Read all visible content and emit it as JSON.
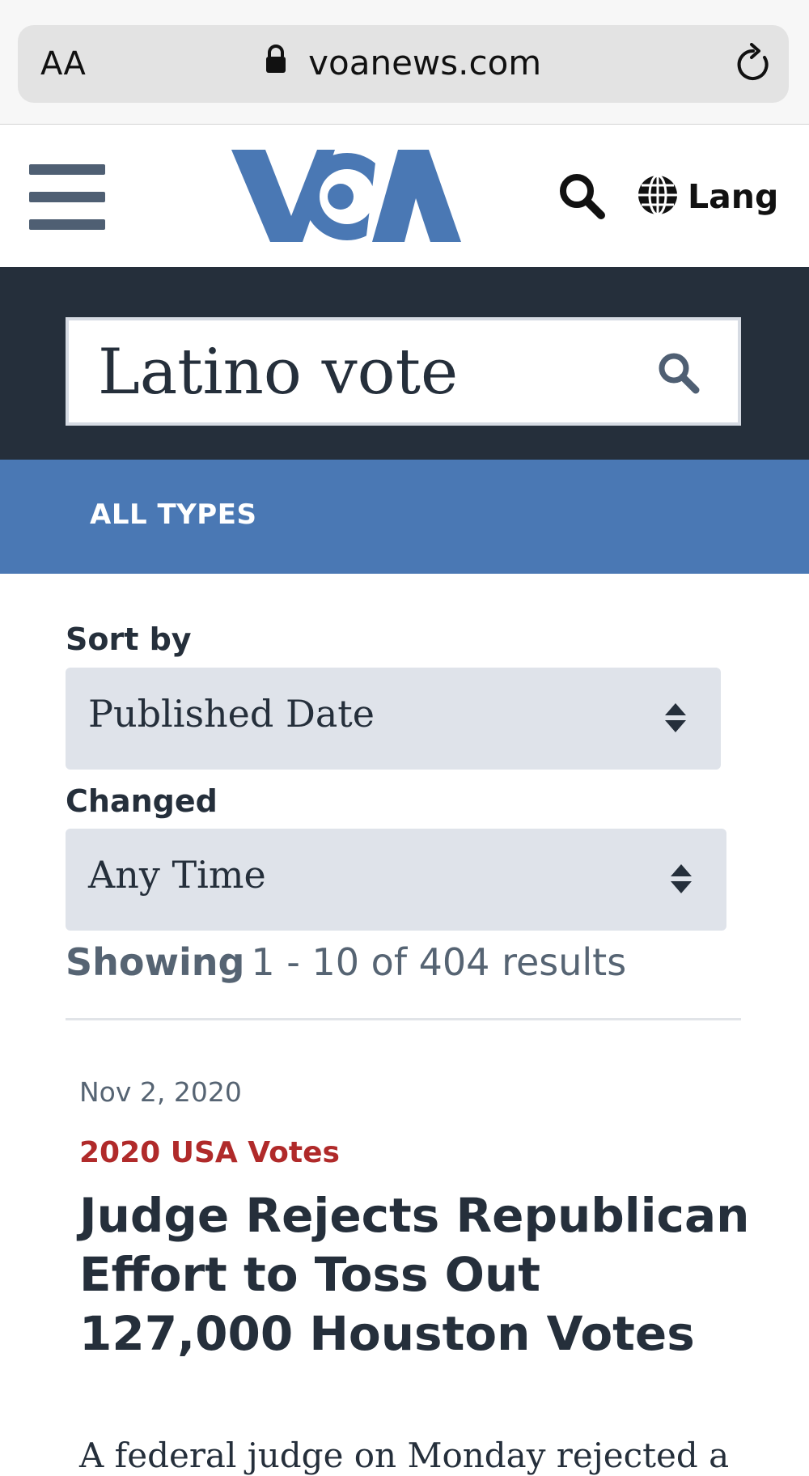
{
  "browser": {
    "text_size_label": "AA",
    "url": "voanews.com",
    "lock_icon": "lock-icon",
    "reload_icon": "reload-icon"
  },
  "header": {
    "menu_icon": "hamburger-menu-icon",
    "logo_text": "VOA",
    "search_icon": "search-icon",
    "lang_icon": "globe-icon",
    "lang_label": "Lang"
  },
  "search": {
    "query": "Latino vote",
    "button_icon": "search-icon"
  },
  "types": {
    "label": "ALL TYPES"
  },
  "filters": {
    "sort_label": "Sort by",
    "sort_value": "Published Date",
    "changed_label": "Changed",
    "changed_value": "Any Time"
  },
  "results": {
    "showing_label": "Showing",
    "showing_range": "1 - 10 of 404 results"
  },
  "articles": [
    {
      "date": "Nov 2, 2020",
      "category": "2020 USA Votes",
      "title": "Judge Rejects Republican Effort to Toss Out 127,000 Houston Votes",
      "excerpt": "A federal judge on Monday rejected a"
    }
  ],
  "colors": {
    "brand_blue": "#4a78b4",
    "dark_navy": "#252f3b",
    "category_red": "#b02a2a",
    "select_bg": "#dfe3ea"
  }
}
